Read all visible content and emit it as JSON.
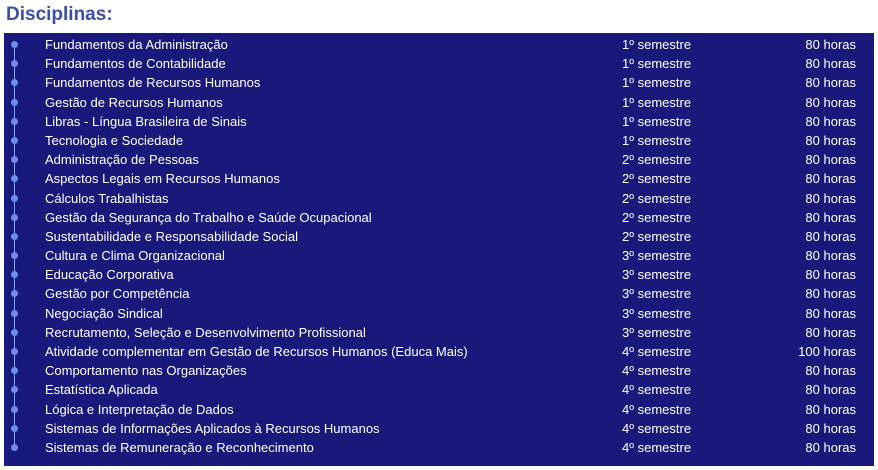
{
  "title": "Disciplinas:",
  "colors": {
    "title": "#3b4fa8",
    "panel": "#18197a",
    "dot": "#6f8cf0",
    "text": "#ffffff"
  },
  "icons": {
    "bullet": "circle-bullet-icon"
  },
  "rows": [
    {
      "name": "Fundamentos da Administração",
      "semester": "1º semestre",
      "hours": "80 horas"
    },
    {
      "name": "Fundamentos de Contabilidade",
      "semester": "1º semestre",
      "hours": "80 horas"
    },
    {
      "name": "Fundamentos de Recursos Humanos",
      "semester": "1º semestre",
      "hours": "80 horas"
    },
    {
      "name": "Gestão de Recursos Humanos",
      "semester": "1º semestre",
      "hours": "80 horas"
    },
    {
      "name": "Libras - Língua Brasileira de Sinais",
      "semester": "1º semestre",
      "hours": "80 horas"
    },
    {
      "name": "Tecnologia e Sociedade",
      "semester": "1º semestre",
      "hours": "80 horas"
    },
    {
      "name": "Administração de Pessoas",
      "semester": "2º semestre",
      "hours": "80 horas"
    },
    {
      "name": "Aspectos Legais em Recursos Humanos",
      "semester": "2º semestre",
      "hours": "80 horas"
    },
    {
      "name": "Cálculos Trabalhistas",
      "semester": "2º semestre",
      "hours": "80 horas"
    },
    {
      "name": "Gestão da Segurança do Trabalho e Saúde Ocupacional",
      "semester": "2º semestre",
      "hours": "80 horas"
    },
    {
      "name": "Sustentabilidade e Responsabilidade Social",
      "semester": "2º semestre",
      "hours": "80 horas"
    },
    {
      "name": "Cultura e Clima Organizacional",
      "semester": "3º semestre",
      "hours": "80 horas"
    },
    {
      "name": "Educação Corporativa",
      "semester": "3º semestre",
      "hours": "80 horas"
    },
    {
      "name": "Gestão por Competência",
      "semester": "3º semestre",
      "hours": "80 horas"
    },
    {
      "name": "Negociação Sindical",
      "semester": "3º semestre",
      "hours": "80 horas"
    },
    {
      "name": "Recrutamento, Seleção e Desenvolvimento Profissional",
      "semester": "3º semestre",
      "hours": "80 horas"
    },
    {
      "name": "Atividade complementar em Gestão de Recursos Humanos (Educa Mais)",
      "semester": "4º semestre",
      "hours": "100 horas"
    },
    {
      "name": "Comportamento nas Organizações",
      "semester": "4º semestre",
      "hours": "80 horas"
    },
    {
      "name": "Estatística Aplicada",
      "semester": "4º semestre",
      "hours": "80 horas"
    },
    {
      "name": "Lógica e Interpretação de Dados",
      "semester": "4º semestre",
      "hours": "80 horas"
    },
    {
      "name": "Sistemas de Informações Aplicados à Recursos Humanos",
      "semester": "4º semestre",
      "hours": "80 horas"
    },
    {
      "name": "Sistemas de Remuneração e Reconhecimento",
      "semester": "4º semestre",
      "hours": "80 horas"
    }
  ]
}
